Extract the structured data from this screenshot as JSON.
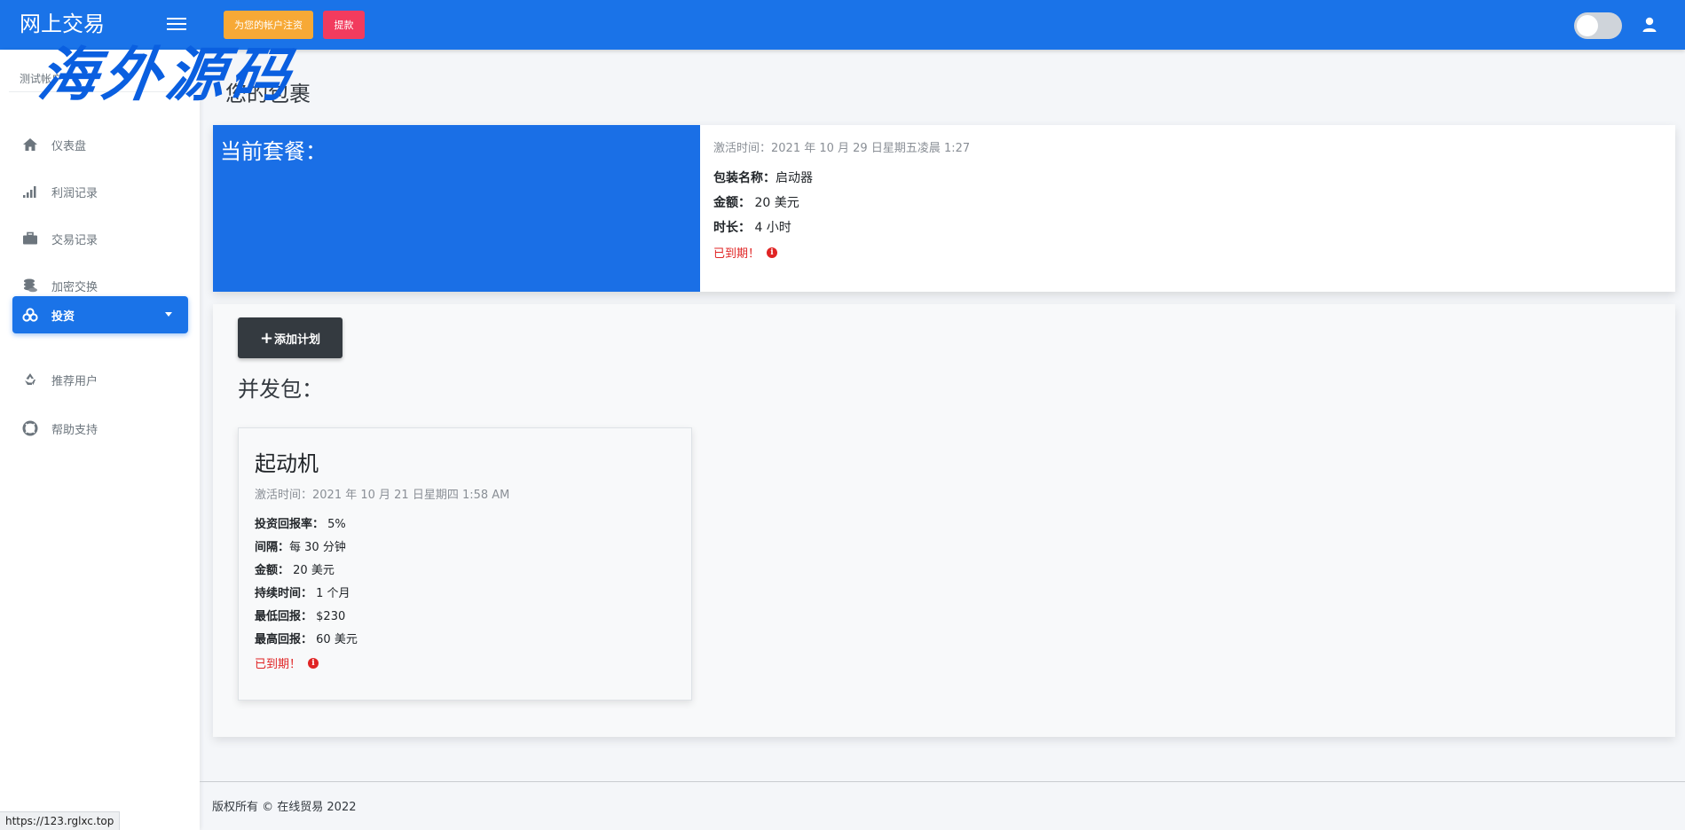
{
  "header": {
    "brand": "网上交易",
    "fund_label": "为您的帐户注资",
    "withdraw_label": "提款"
  },
  "sidebar": {
    "user": "测试帐户",
    "items": [
      {
        "label": "仪表盘",
        "icon": "home-icon"
      },
      {
        "label": "利润记录",
        "icon": "signal-icon"
      },
      {
        "label": "交易记录",
        "icon": "briefcase-icon"
      },
      {
        "label": "加密交换",
        "icon": "coins-icon"
      },
      {
        "label": "投资",
        "icon": "cubes-icon",
        "active": true
      },
      {
        "label": "推荐用户",
        "icon": "recycle-icon"
      },
      {
        "label": "帮助支持",
        "icon": "life-ring-icon"
      }
    ]
  },
  "watermark": "海外源码",
  "main": {
    "page_title": "您的包裹",
    "current_plan": {
      "heading": "当前套餐：",
      "activated": "激活时间：2021 年 10 月 29 日星期五凌晨 1:27",
      "name_label": "包装名称：",
      "name_value": "启动器",
      "amount_label": "金额：",
      "amount_value": "20 美元",
      "duration_label": "时长：",
      "duration_value": "4 小时",
      "status": "已到期！"
    },
    "add_plan_label": "添加计划",
    "packages_heading": "并发包：",
    "package": {
      "title": "起动机",
      "activated": "激活时间：2021 年 10 月 21 日星期四 1:58 AM",
      "rows": [
        {
          "label": "投资回报率：",
          "value": "5%"
        },
        {
          "label": "间隔：",
          "value": "每 30 分钟"
        },
        {
          "label": "金额：",
          "value": "20 美元"
        },
        {
          "label": "持续时间：",
          "value": "1 个月"
        },
        {
          "label": "最低回报：",
          "value": "$230"
        },
        {
          "label": "最高回报：",
          "value": "60 美元"
        }
      ],
      "status": "已到期！"
    }
  },
  "footer": "版权所有 © 在线贸易 2022",
  "status_url": "https://123.rglxc.top",
  "colors": {
    "primary": "#1a73e8",
    "fund": "#f7a936",
    "withdraw": "#f23b5e",
    "expired": "#e02424"
  }
}
